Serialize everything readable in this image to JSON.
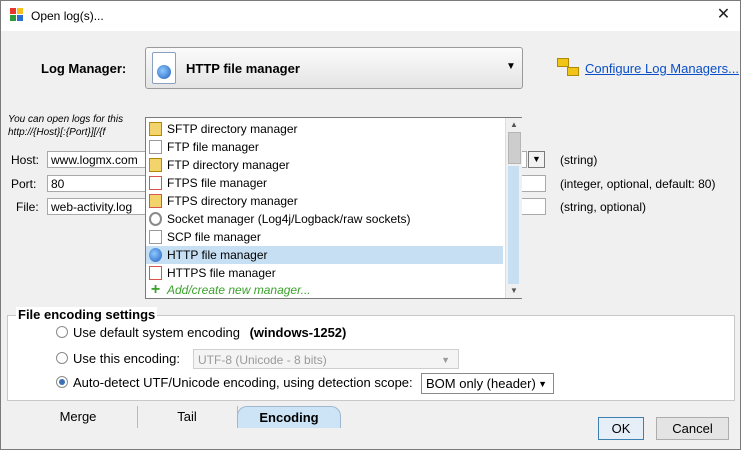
{
  "window": {
    "title": "Open log(s)...",
    "close_glyph": "✕"
  },
  "log_manager": {
    "label": "Log Manager:",
    "selected": "HTTP file manager",
    "configure_link": "Configure Log Managers..."
  },
  "info_text": {
    "line1": "You can open logs for this",
    "line2": "http://{Host}[:{Port}][/{f"
  },
  "fields": {
    "host": {
      "label": "Host:",
      "value": "www.logmx.com",
      "hint": "(string)"
    },
    "port": {
      "label": "Port:",
      "value": "80",
      "hint": "(integer, optional, default: 80)"
    },
    "file": {
      "label": "File:",
      "value": "web-activity.log",
      "hint": "(string, optional)"
    }
  },
  "manager_list": [
    {
      "label": "SFTP directory manager",
      "icon": "folder-icon"
    },
    {
      "label": "FTP file manager",
      "icon": "document-icon"
    },
    {
      "label": "FTP directory manager",
      "icon": "folder-icon"
    },
    {
      "label": "FTPS file manager",
      "icon": "lock-document-icon"
    },
    {
      "label": "FTPS directory manager",
      "icon": "lock-folder-icon"
    },
    {
      "label": "Socket manager (Log4j/Logback/raw sockets)",
      "icon": "socket-icon"
    },
    {
      "label": "SCP file manager",
      "icon": "document-icon"
    },
    {
      "label": "HTTP file manager",
      "icon": "globe-icon"
    },
    {
      "label": "HTTPS file manager",
      "icon": "lock-document-icon"
    },
    {
      "label": "Add/create new manager...",
      "icon": "plus-icon"
    }
  ],
  "encoding": {
    "title": "File encoding settings",
    "opt_default": "Use default system encoding",
    "default_value": "(windows-1252)",
    "opt_this": "Use this encoding:",
    "this_value": "UTF-8  (Unicode - 8 bits)",
    "opt_auto": "Auto-detect UTF/Unicode encoding, using detection scope:",
    "scope_value": "BOM only (header)",
    "selected_option": "auto"
  },
  "tabs": [
    "Merge",
    "Tail",
    "Encoding"
  ],
  "active_tab": "Encoding",
  "buttons": {
    "ok": "OK",
    "cancel": "Cancel"
  },
  "colors": {
    "accent": "#c7dff3",
    "link": "#0b4fc8",
    "add_item": "#3aa12b"
  }
}
